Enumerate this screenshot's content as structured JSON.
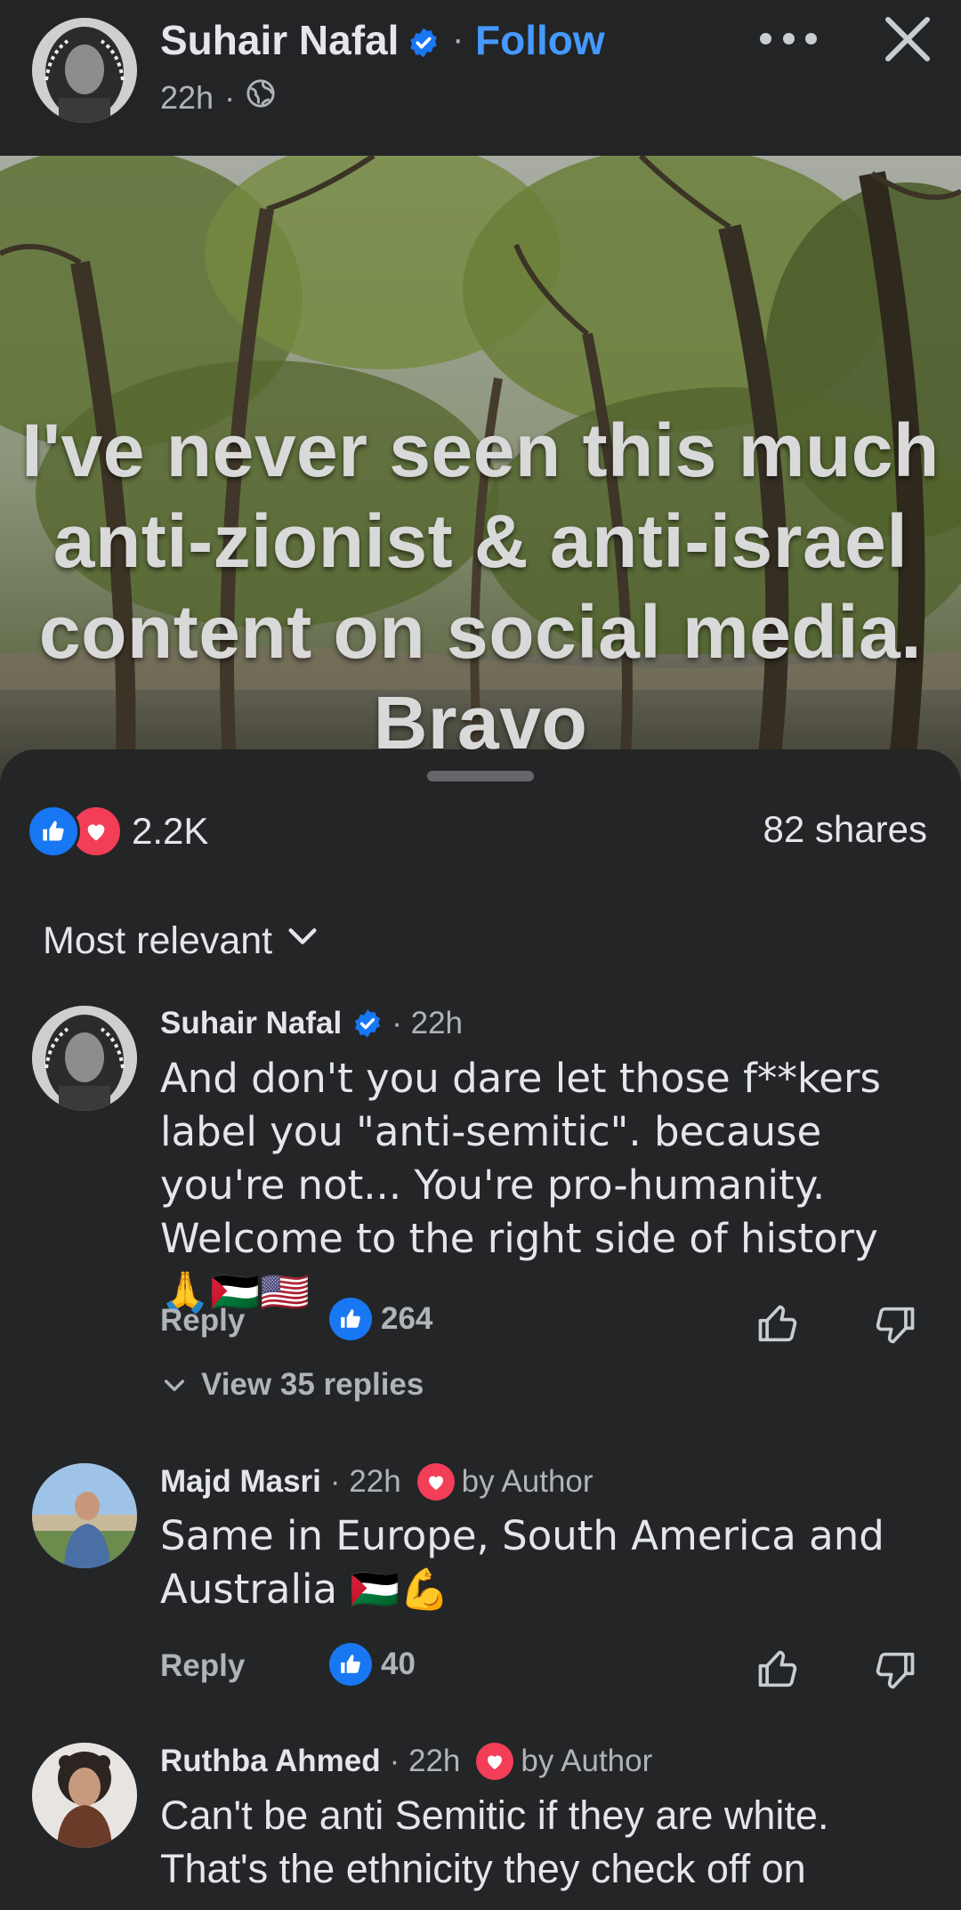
{
  "header": {
    "author_name": "Suhair Nafal",
    "follow_label": "Follow",
    "separator": "·",
    "post_time": "22h",
    "privacy_icon": "globe-icon",
    "more_icon": "more-options-icon",
    "close_icon": "close-icon"
  },
  "post": {
    "overlay_text": "I've never seen this much anti-zionist & anti-israel content on social media. Bravo",
    "image_description": "forest-river-photo"
  },
  "engagement": {
    "reaction_count": "2.2K",
    "shares": "82 shares",
    "reaction_icons": [
      "like-icon",
      "love-icon"
    ]
  },
  "sort": {
    "label": "Most relevant"
  },
  "comments": [
    {
      "name": "Suhair Nafal",
      "verified": true,
      "time": "· 22h",
      "text": "And don't you dare let those f**kers label you \"anti-semitic\". because you're not... You're pro-humanity. Welcome to the right side of history 🙏🇵🇸🇺🇸",
      "reply_label": "Reply",
      "likes": "264",
      "view_replies": "View 35 replies"
    },
    {
      "name": "Majd Masri",
      "time": "· 22h",
      "badge": "by Author",
      "text": "Same in Europe, South America and Australia 🇵🇸💪",
      "reply_label": "Reply",
      "likes": "40"
    },
    {
      "name": "Ruthba Ahmed",
      "time": "· 22h",
      "badge": "by Author",
      "text": "Can't be anti Semitic if they are white. That's the ethnicity they check off on"
    }
  ],
  "colors": {
    "background": "#242526",
    "header_bg": "#232425",
    "accent_blue": "#4599ff",
    "like_blue": "#1877f2",
    "love_red": "#f33e58",
    "text_primary": "#e4e6eb",
    "text_secondary": "#b0b3b8"
  }
}
